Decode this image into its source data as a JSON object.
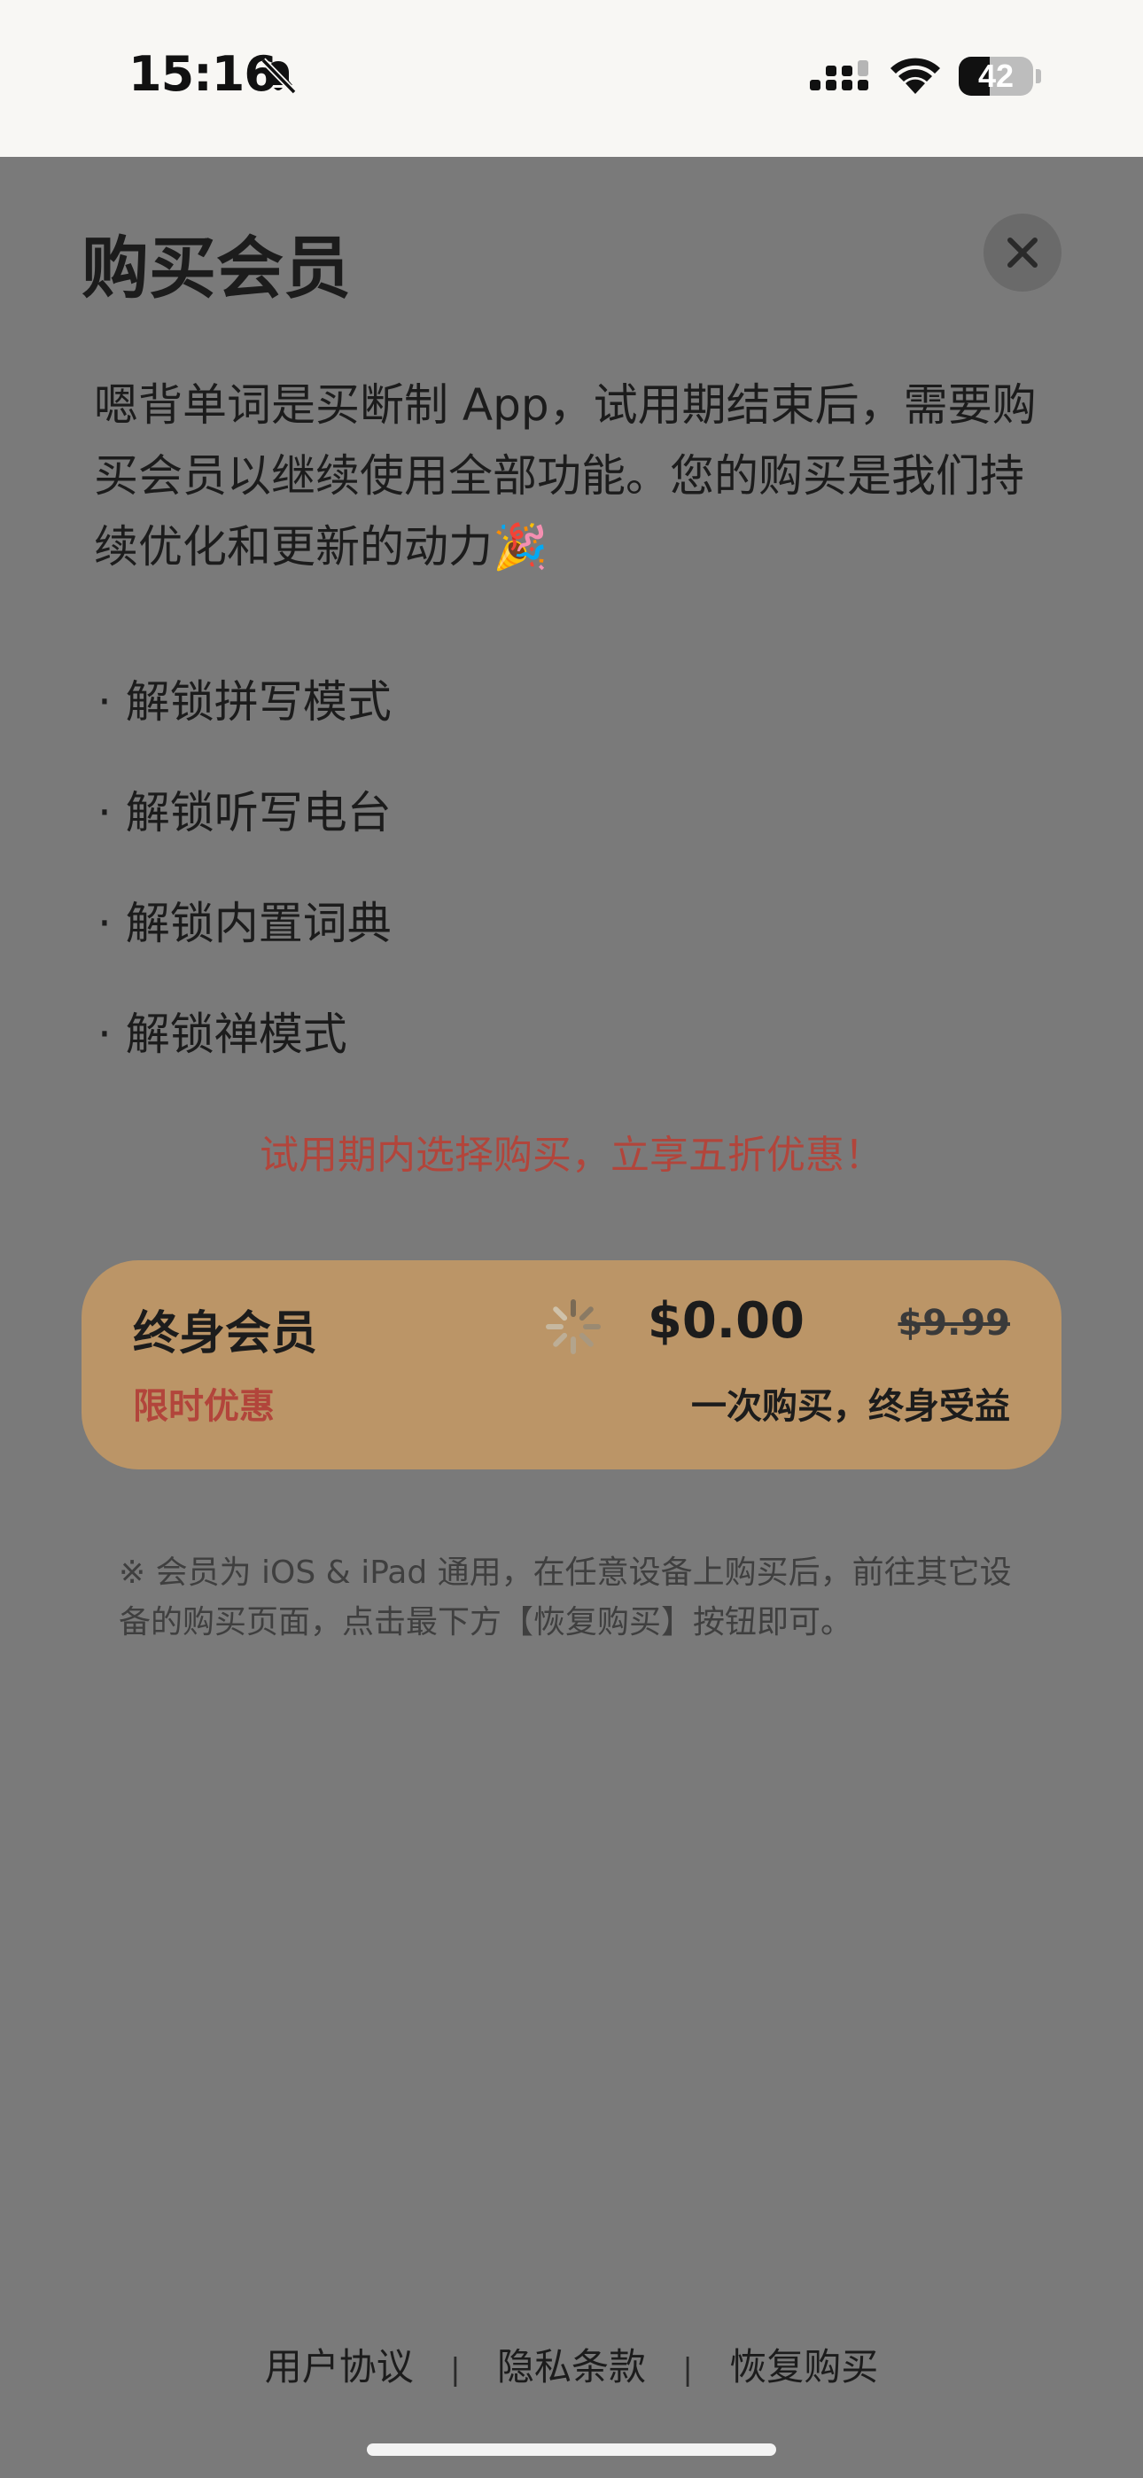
{
  "status_bar": {
    "time": "15:16",
    "battery": "42",
    "battery_level_percent": 42,
    "icons": [
      "bell-slash-icon",
      "cellular-signal-icon",
      "wifi-icon",
      "battery-icon"
    ]
  },
  "sheet": {
    "title": "购买会员",
    "intro": "嗯背单词是买断制 App，试用期结束后，需要购买会员以继续使用全部功能。您的购买是我们持续优化和更新的动力🎉",
    "features": [
      "· 解锁拼写模式",
      "· 解锁听写电台",
      "· 解锁内置词典",
      "· 解锁禅模式"
    ],
    "promo": "试用期内选择购买，立享五折优惠！",
    "plan": {
      "name": "终身会员",
      "badge": "限时优惠",
      "price": "$0.00",
      "original_price": "$9.99",
      "tagline": "一次购买，终身受益"
    },
    "note": "※ 会员为 iOS & iPad 通用，在任意设备上购买后，前往其它设备的购买页面，点击最下方【恢复购买】按钮即可。"
  },
  "footer": {
    "terms": "用户协议",
    "privacy": "隐私条款",
    "restore": "恢复购买",
    "separator": "|"
  },
  "colors": {
    "accent_red": "#b2453b",
    "card_gold": "#bb9567",
    "overlay_gray": "#7a7a7a"
  }
}
